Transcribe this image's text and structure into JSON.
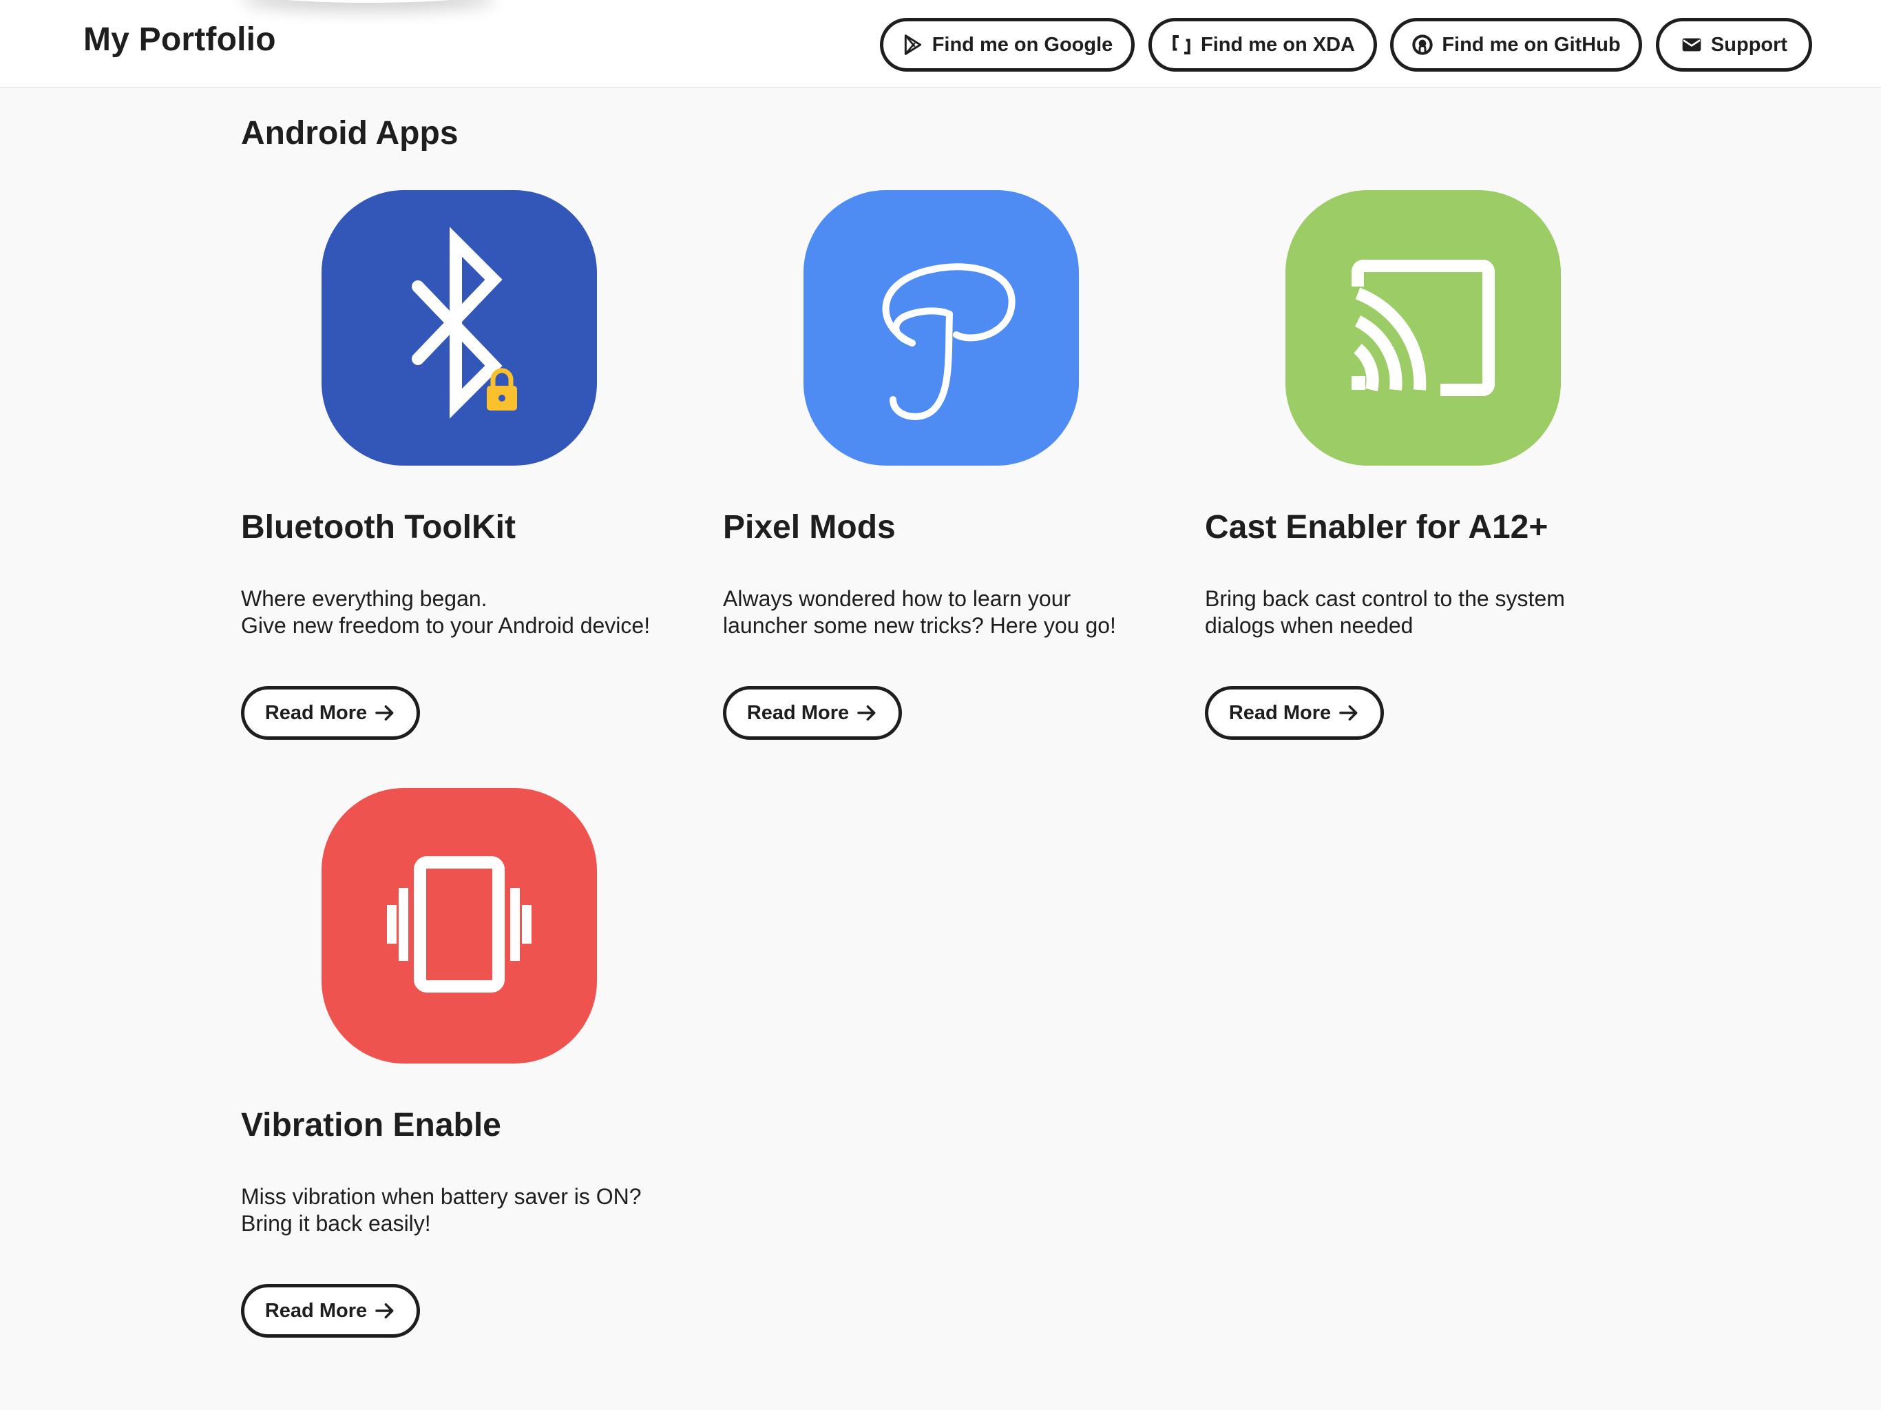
{
  "header": {
    "brand": "My Portfolio",
    "nav": [
      {
        "label": "Find me on Google",
        "icon": "play-store-icon"
      },
      {
        "label": "Find me on XDA",
        "icon": "xda-icon"
      },
      {
        "label": "Find me on GitHub",
        "icon": "github-icon"
      },
      {
        "label": "Support",
        "icon": "envelope-icon"
      }
    ]
  },
  "section": {
    "title": "Android Apps"
  },
  "apps": [
    {
      "title": "Bluetooth ToolKit",
      "desc_lines": [
        "Where everything began.",
        "Give new freedom to your Android device!"
      ],
      "button": "Read More",
      "icon": "bluetooth-lock-icon",
      "color": "#3357b9"
    },
    {
      "title": "Pixel Mods",
      "desc_lines": [
        "Always wondered how to learn your",
        "launcher some new tricks? Here you go!"
      ],
      "button": "Read More",
      "icon": "script-p-icon",
      "color": "#4e8cf4"
    },
    {
      "title": "Cast Enabler for A12+",
      "desc_lines": [
        "Bring back cast control to the system",
        "dialogs when needed"
      ],
      "button": "Read More",
      "icon": "cast-icon",
      "color": "#9ccc65"
    },
    {
      "title": "Vibration Enable",
      "desc_lines": [
        "Miss vibration when battery saver is ON?",
        "Bring it back easily!"
      ],
      "button": "Read More",
      "icon": "vibration-icon",
      "color": "#ef5350"
    }
  ],
  "colors": {
    "page_bg": "#f9f9f9",
    "header_bg": "#ffffff",
    "text": "#1e1e1e",
    "lock_yellow": "#fbc02d"
  }
}
